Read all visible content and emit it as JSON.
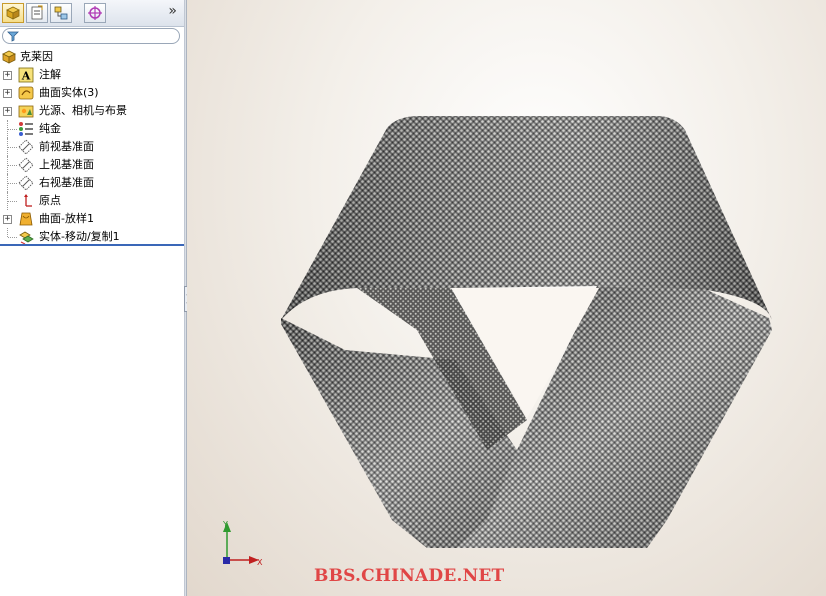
{
  "feature_tree": {
    "root": {
      "label": "克莱因",
      "icon": "part-icon"
    },
    "items": [
      {
        "label": "注解",
        "icon": "annotation-icon",
        "expandable": true
      },
      {
        "label": "曲面实体(3)",
        "icon": "surface-bodies-icon",
        "expandable": true
      },
      {
        "label": "光源、相机与布景",
        "icon": "lights-cameras-icon",
        "expandable": true
      },
      {
        "label": "纯金",
        "icon": "material-icon",
        "expandable": false
      },
      {
        "label": "前视基准面",
        "icon": "plane-icon",
        "expandable": false
      },
      {
        "label": "上视基准面",
        "icon": "plane-icon",
        "expandable": false
      },
      {
        "label": "右视基准面",
        "icon": "plane-icon",
        "expandable": false
      },
      {
        "label": "原点",
        "icon": "origin-icon",
        "expandable": false
      },
      {
        "label": "曲面-放样1",
        "icon": "loft-surface-icon",
        "expandable": true
      },
      {
        "label": "实体-移动/复制1",
        "icon": "move-copy-icon",
        "expandable": false
      }
    ]
  },
  "panel_tabs": [
    {
      "name": "featuremanager-tab",
      "icon": "featuremanager-icon",
      "active": true
    },
    {
      "name": "propertymanager-tab",
      "icon": "propertymanager-icon",
      "active": false
    },
    {
      "name": "configurationmanager-tab",
      "icon": "configuration-icon",
      "active": false
    },
    {
      "name": "dimxpert-tab",
      "icon": "target-icon",
      "active": false
    }
  ],
  "expand_panel_glyph": "»",
  "filter_icon": "filter-icon",
  "viewport": {
    "watermark": "BBS.CHINADE.NET",
    "triad": {
      "x_label": "X",
      "y_label": "Y"
    }
  },
  "colors": {
    "watermark": "#e04646",
    "selection_line": "#3a67b8"
  }
}
